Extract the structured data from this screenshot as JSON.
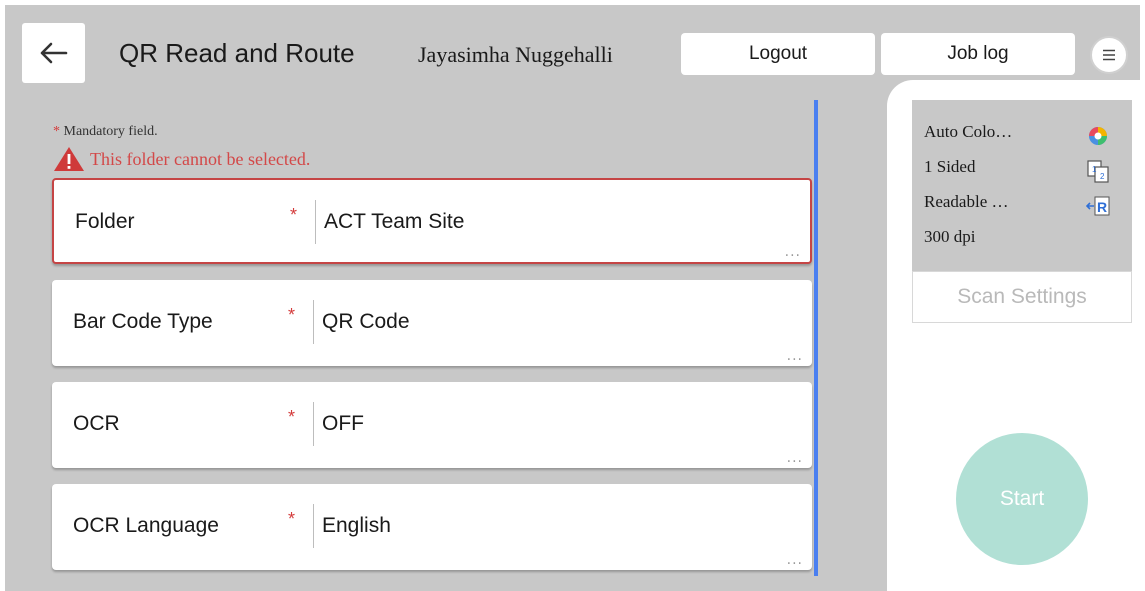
{
  "header": {
    "title": "QR Read and Route",
    "user_name": "Jayasimha Nuggehalli",
    "logout_label": "Logout",
    "joblog_label": "Job log"
  },
  "form": {
    "mandatory_star": "*",
    "mandatory_note": "Mandatory field.",
    "error_message": "This folder cannot be selected.",
    "fields": [
      {
        "label": "Folder",
        "value": "ACT Team Site",
        "required": "*",
        "more": "...",
        "state": "error"
      },
      {
        "label": "Bar Code Type",
        "value": "QR Code",
        "required": "*",
        "more": "..."
      },
      {
        "label": "OCR",
        "value": "OFF",
        "required": "*",
        "more": "..."
      },
      {
        "label": "OCR Language",
        "value": "English",
        "required": "*",
        "more": "..."
      }
    ]
  },
  "scan_summary": {
    "items": [
      {
        "text": "Auto Colo…",
        "icon": "auto-color-icon"
      },
      {
        "text": "1 Sided",
        "icon": "one-sided-icon"
      },
      {
        "text": "Readable …",
        "icon": "readable-orientation-icon"
      },
      {
        "text": "300 dpi",
        "icon": ""
      }
    ],
    "scan_settings_label": "Scan Settings",
    "start_label": "Start"
  },
  "colors": {
    "background": "#c8c8c8",
    "error": "#c54545",
    "accent_blue": "#4a7ff0",
    "start_button": "#b1e0d5"
  }
}
